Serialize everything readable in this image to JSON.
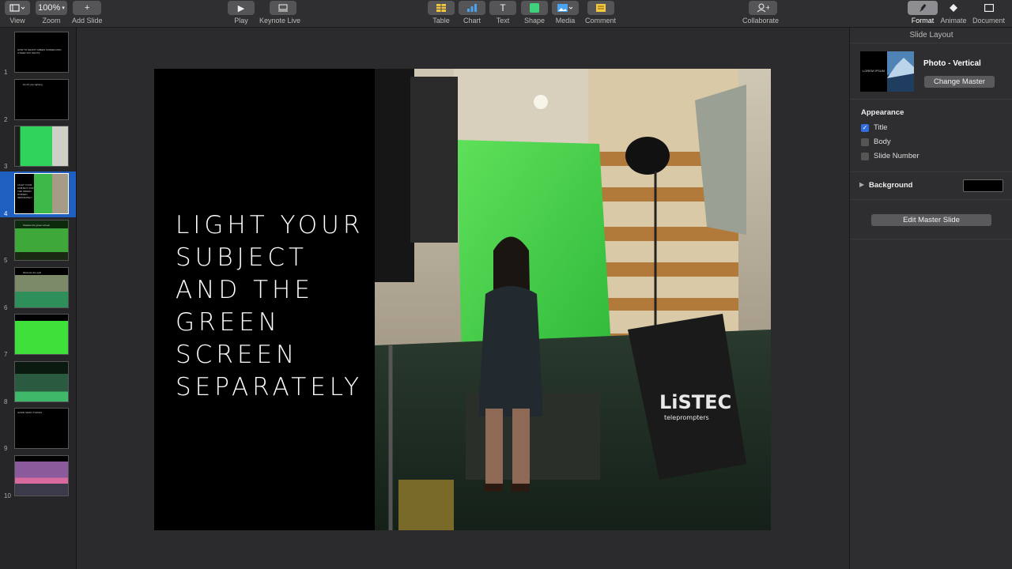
{
  "toolbar": {
    "view": "View",
    "zoom_value": "100%",
    "zoom": "Zoom",
    "add_slide": "Add Slide",
    "play": "Play",
    "keynote_live": "Keynote Live",
    "table": "Table",
    "chart": "Chart",
    "text": "Text",
    "shape": "Shape",
    "media": "Media",
    "comment": "Comment",
    "collaborate": "Collaborate",
    "format": "Format",
    "animate": "Animate",
    "document": "Document"
  },
  "sidebar": {
    "selected": 4,
    "slides": [
      {
        "num": "1",
        "text": "HOW TO SHOOT GREEN SCREEN AND OTHER VFX SHOTS"
      },
      {
        "num": "2",
        "text": "Do lift your lighting"
      },
      {
        "num": "3",
        "text": ""
      },
      {
        "num": "4",
        "text": "LIGHT YOUR SUBJECT AND THE GREEN SCREEN SEPARATELY"
      },
      {
        "num": "5",
        "text": "Shadow the green screen"
      },
      {
        "num": "6",
        "text": "Minimize the spill"
      },
      {
        "num": "7",
        "text": ""
      },
      {
        "num": "8",
        "text": ""
      },
      {
        "num": "9",
        "text": "AVOID SHINY THINGS"
      },
      {
        "num": "10",
        "text": ""
      }
    ]
  },
  "slide": {
    "title_lines": [
      "LIGHT YOUR",
      "SUBJECT",
      "AND THE",
      "GREEN",
      "SCREEN",
      "SEPARATELY"
    ]
  },
  "photo": {
    "brand": "LiSTEC",
    "brand_sub": "teleprompters"
  },
  "inspector": {
    "header": "Slide Layout",
    "master_name": "Photo - Vertical",
    "master_thumb_text": "LOREM IPSUM",
    "change_master": "Change Master",
    "appearance": "Appearance",
    "title": "Title",
    "body": "Body",
    "slide_number": "Slide Number",
    "background": "Background",
    "edit_master": "Edit Master Slide",
    "title_checked": true,
    "body_checked": false,
    "slide_number_checked": false,
    "background_color": "#000000"
  },
  "colors": {
    "accent": "#2f6de1",
    "selection": "#1f5fbf"
  }
}
